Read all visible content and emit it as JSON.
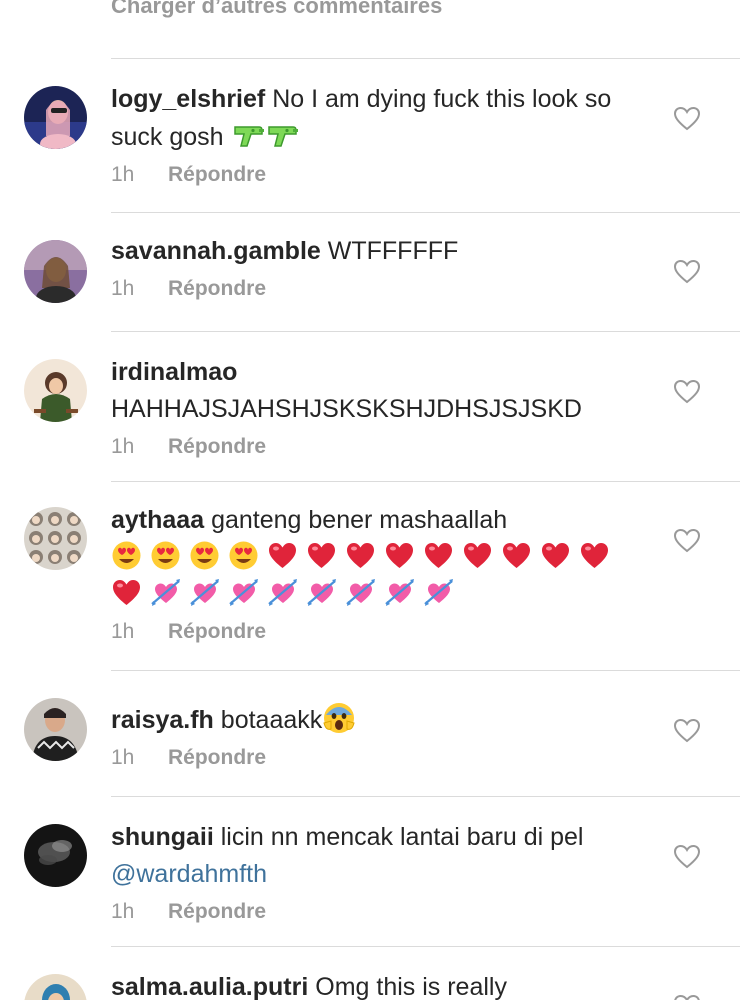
{
  "load_more": "Charger d’autres commentaires",
  "reply_label": "Répondre",
  "colors": {
    "text": "#262626",
    "secondary": "#999999",
    "divider": "#dbdbdb",
    "mention": "#3f729b"
  },
  "comments": [
    {
      "username": "logy_elshrief",
      "text": "No I am dying fuck this look so suck gosh",
      "emoji_icons": [
        "water-pistol-icon",
        "water-pistol-icon"
      ],
      "time": "1h"
    },
    {
      "username": "savannah.gamble",
      "text": "WTFFFFFF",
      "time": "1h"
    },
    {
      "username": "irdinalmao",
      "text": "HAHHAJSJAHSHJSKSKSHJDHSJSJSKD",
      "time": "1h"
    },
    {
      "username": "aythaaa",
      "text": "ganteng bener mashaallah",
      "emoji_icons": [
        "heart-eyes-face-icon",
        "heart-eyes-face-icon",
        "heart-eyes-face-icon",
        "heart-eyes-face-icon",
        "red-heart-icon",
        "red-heart-icon",
        "red-heart-icon",
        "red-heart-icon",
        "red-heart-icon",
        "red-heart-icon",
        "red-heart-icon",
        "red-heart-icon",
        "red-heart-icon",
        "red-heart-icon",
        "heart-with-arrow-icon",
        "heart-with-arrow-icon",
        "heart-with-arrow-icon",
        "heart-with-arrow-icon",
        "heart-with-arrow-icon",
        "heart-with-arrow-icon",
        "heart-with-arrow-icon",
        "heart-with-arrow-icon"
      ],
      "time": "1h"
    },
    {
      "username": "raisya.fh",
      "text": "botaaakk",
      "emoji_icons": [
        "screaming-face-icon"
      ],
      "time": "1h"
    },
    {
      "username": "shungaii",
      "text": "licin nn mencak lantai baru di pel",
      "mention": "@wardahmfth",
      "time": "1h"
    },
    {
      "username": "salma.aulia.putri",
      "text": "Omg this is really"
    }
  ]
}
